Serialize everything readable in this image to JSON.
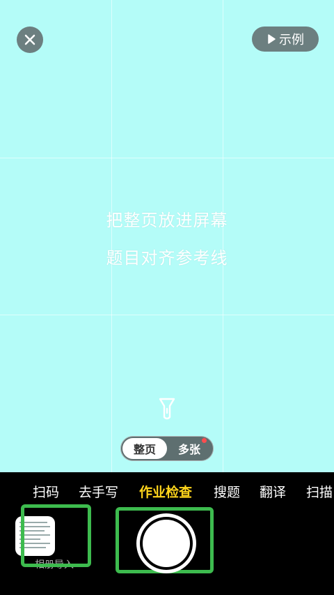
{
  "camera": {
    "instruction_line1": "把整页放进屏幕",
    "instruction_line2": "题目对齐参考线",
    "example_label": "示例",
    "mode_switch": {
      "active": "整页",
      "inactive": "多张"
    }
  },
  "tabs": [
    {
      "label": "扫码"
    },
    {
      "label": "去手写"
    },
    {
      "label": "作业检查",
      "active": true
    },
    {
      "label": "搜题"
    },
    {
      "label": "翻译"
    },
    {
      "label": "扫描"
    }
  ],
  "album": {
    "label": "相册导入"
  },
  "colors": {
    "viewfinder": "#b4fcf8",
    "active_tab": "#ffd51c",
    "highlight_box": "#3dbb4e"
  },
  "icons": {
    "close": "close-icon",
    "example": "play-icon",
    "flash": "flashlight-icon"
  }
}
